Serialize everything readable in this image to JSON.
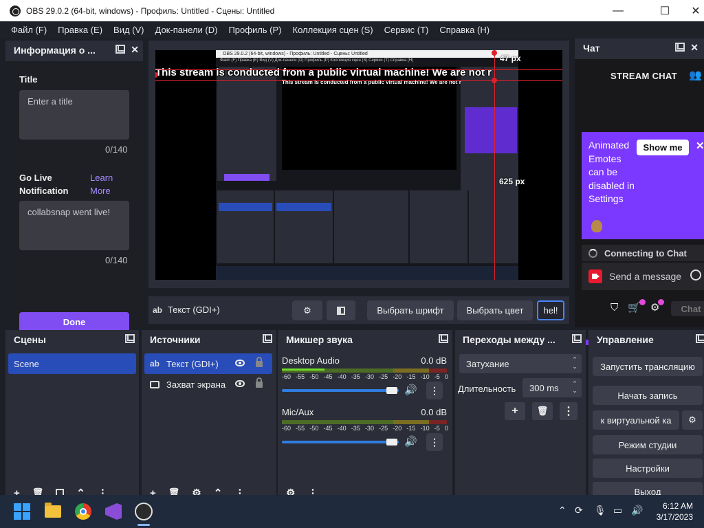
{
  "window": {
    "title": "OBS 29.0.2 (64-bit, windows) - Профиль: Untitled - Сцены: Untitled",
    "minimize": "—",
    "maximize": "☐",
    "close": "✕"
  },
  "menu": [
    "Файл (F)",
    "Правка (E)",
    "Вид (V)",
    "Док-панели (D)",
    "Профиль (P)",
    "Коллекция сцен (S)",
    "Сервис (T)",
    "Справка (H)"
  ],
  "info_dock": {
    "title": "Информация о ...",
    "title_label": "Title",
    "title_placeholder": "Enter a title",
    "title_count": "0/140",
    "go_live_label": "Go Live Notification",
    "learn_more": "Learn More",
    "notification_value": "collabsnap went live!",
    "notification_count": "0/140",
    "done": "Done"
  },
  "preview": {
    "banner": "This stream is conducted from a public virtual machine! We are not r",
    "banner_small": "This stream is conducted from a public virtual machine! We are not r",
    "top_px": "47 px",
    "bottom_px": "625 px",
    "mini_title": "OBS 29.0.2 (64-bit, windows) - Профиль: Untitled - Сцены: Untitled",
    "mini_menu": "Файл (F)   Правка (E)   Вид (V)   Док-панели (D)   Профиль (P)   Коллекция сцен (S)   Сервис (T)   Справка (H)"
  },
  "source_toolbar": {
    "source_name": "Текст (GDI+)",
    "choose_font": "Выбрать шрифт",
    "choose_color": "Выбрать цвет",
    "text_field": "hel!"
  },
  "chat_dock": {
    "title": "Чат",
    "header": "STREAM CHAT",
    "toast_text": "Animated Emotes can be disabled in Settings",
    "show_me": "Show me",
    "connecting": "Connecting to Chat",
    "send_placeholder": "Send a message",
    "chat_button": "Chat"
  },
  "scenes": {
    "title": "Сцены",
    "items": [
      "Scene"
    ]
  },
  "sources": {
    "title": "Источники",
    "items": [
      "Текст (GDI+)",
      "Захват экрана"
    ]
  },
  "mixer": {
    "title": "Микшер звука",
    "channels": [
      {
        "name": "Desktop Audio",
        "db": "0.0 dB"
      },
      {
        "name": "Mic/Aux",
        "db": "0.0 dB"
      }
    ],
    "scale": [
      "-60",
      "-55",
      "-50",
      "-45",
      "-40",
      "-35",
      "-30",
      "-25",
      "-20",
      "-15",
      "-10",
      "-5",
      "0"
    ]
  },
  "transitions": {
    "title": "Переходы между ...",
    "selected": "Затухание",
    "duration_label": "Длительность",
    "duration_value": "300 ms"
  },
  "controls": {
    "title": "Управление",
    "start_stream": "Запустить трансляцию",
    "start_record": "Начать запись",
    "virtual_cam": "к виртуальной ка",
    "studio_mode": "Режим студии",
    "settings": "Настройки",
    "exit": "Выход"
  },
  "taskbar": {
    "time": "6:12 AM",
    "date": "3/17/2023"
  },
  "icons": {
    "gear": "⚙",
    "plus": "+",
    "trash": "🗑",
    "up": "⌃",
    "kebab": "⋮",
    "speaker": "🔊",
    "shield": "⛉",
    "cart": "🛒",
    "people": "👥",
    "cursor": "Ꮖ"
  }
}
